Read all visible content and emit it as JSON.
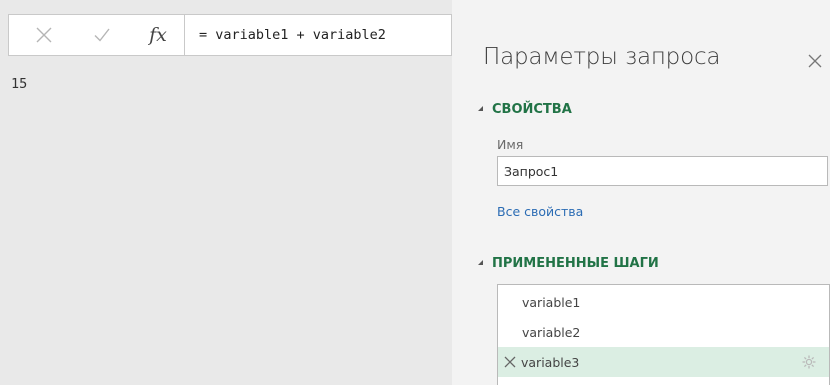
{
  "formula_bar": {
    "cancel_icon": "close-x-icon",
    "commit_icon": "checkmark-icon",
    "fx_label": "fx",
    "formula": "= variable1 + variable2"
  },
  "result": {
    "value": "15"
  },
  "query_settings": {
    "title": "Параметры запроса",
    "close_icon": "close-x-icon",
    "properties": {
      "header": "СВОЙСТВА",
      "name_label": "Имя",
      "name_value": "Запрос1",
      "all_properties_link": "Все свойства"
    },
    "applied_steps": {
      "header": "ПРИМЕНЕННЫЕ ШАГИ",
      "steps": [
        {
          "label": "variable1",
          "selected": false
        },
        {
          "label": "variable2",
          "selected": false
        },
        {
          "label": "variable3",
          "selected": true,
          "delete_icon": "close-x-icon",
          "settings_icon": "gear-icon"
        }
      ]
    }
  },
  "colors": {
    "section_header": "#217346",
    "link": "#2b6cb4",
    "selected_step_bg": "#dbeee3"
  }
}
